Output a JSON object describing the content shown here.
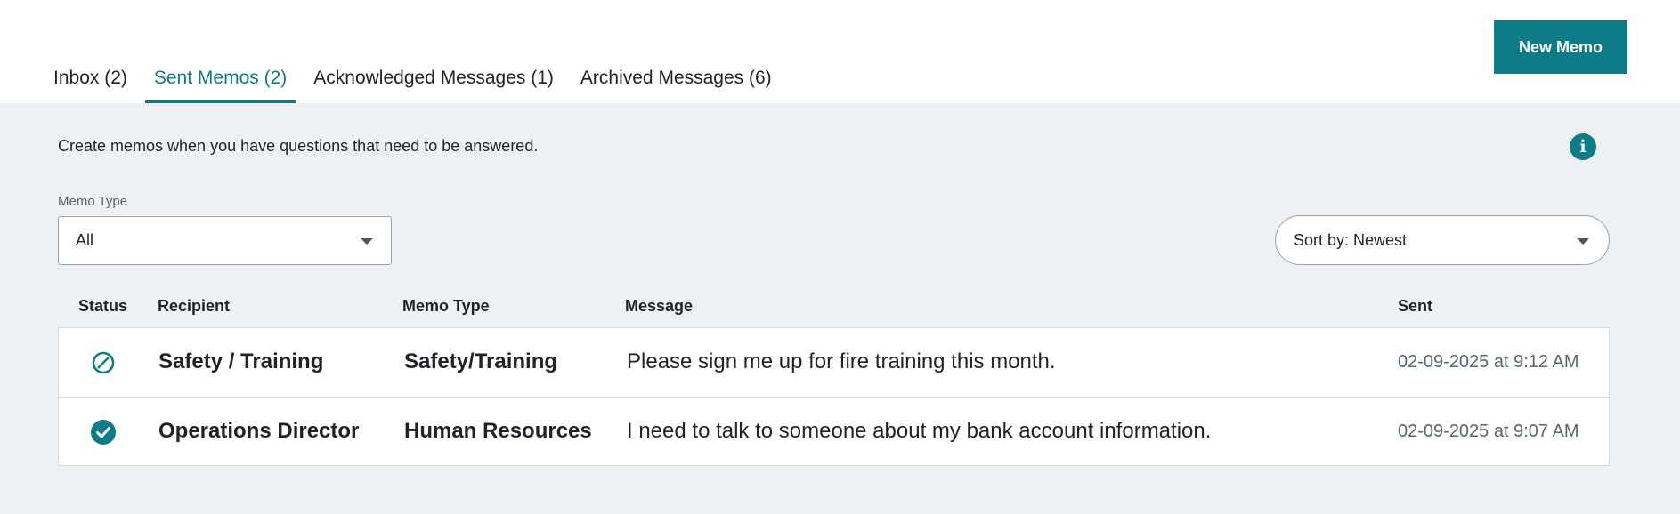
{
  "header": {
    "tabs": [
      {
        "label": "Inbox (2)",
        "active": false
      },
      {
        "label": "Sent Memos (2)",
        "active": true
      },
      {
        "label": "Acknowledged Messages (1)",
        "active": false
      },
      {
        "label": "Archived Messages (6)",
        "active": false
      }
    ],
    "new_memo_label": "New Memo",
    "accent_color": "#0e7c86"
  },
  "main": {
    "intro_text": "Create memos when you have questions that need to be answered.",
    "info_icon": "info-icon",
    "filter": {
      "label": "Memo Type",
      "selected": "All"
    },
    "sort": {
      "selected": "Sort by: Newest"
    }
  },
  "table": {
    "columns": [
      "Status",
      "Recipient",
      "Memo Type",
      "Message",
      "Sent"
    ],
    "rows": [
      {
        "status_icon": "not-acknowledged-icon",
        "recipient": "Safety / Training",
        "memo_type": "Safety/Training",
        "message": "Please sign me up for fire training this month.",
        "sent": "02-09-2025 at 9:12 AM"
      },
      {
        "status_icon": "acknowledged-check-icon",
        "recipient": "Operations Director",
        "memo_type": "Human Resources",
        "message": "I need to talk to someone about my bank account information.",
        "sent": "02-09-2025 at 9:07 AM"
      }
    ]
  }
}
